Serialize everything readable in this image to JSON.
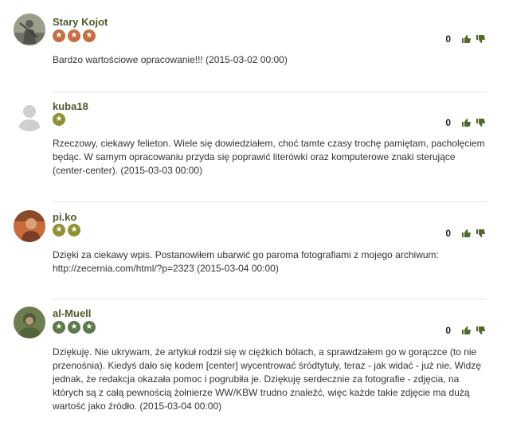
{
  "comments": [
    {
      "username": "Stary Kojot",
      "rank_count": 3,
      "rank_color": "#c76d42",
      "score": "0",
      "text": "Bardzo wartościowe opracowanie!!! (2015-03-02 00:00)"
    },
    {
      "username": "kuba18",
      "rank_count": 1,
      "rank_color": "#8f9133",
      "score": "0",
      "text": "Rzeczowy, ciekawy felieton. Wiele się dowiedziałem, choć tamte czasy trochę pamiętam, pacholęciem będąc. W samym opracowaniu przyda się poprawić literówki oraz komputerowe znaki sterujące (center-center). (2015-03-03 00:00)"
    },
    {
      "username": "pi.ko",
      "rank_count": 2,
      "rank_color": "#8f9133",
      "score": "0",
      "text": "Dzięki za ciekawy wpis. Postanowiłem ubarwić go paroma fotografiami z mojego archiwum: http://zecernia.com/html/?p=2323 (2015-03-04 00:00)"
    },
    {
      "username": "al-Muell",
      "rank_count": 3,
      "rank_color": "#5b7a4a",
      "score": "0",
      "text": "Dziękuję. Nie ukrywam, że artykuł rodził się w ciężkich bólach, a sprawdzałem go w gorączce (to nie przenośnia). Kiedyś dało się kodem [center] wycentrować śródtytuły, teraz - jak widać - już nie. Widzę jednak, że redakcja okazała pomoc i pogrubiła je. Dziękuję serdecznie za fotografie - zdjęcia, na których są z całą pewnością żołnierze WW/KBW trudno znaleźć, więc każde takie zdjęcie ma dużą wartość jako źródło. (2015-03-04 00:00)"
    }
  ]
}
